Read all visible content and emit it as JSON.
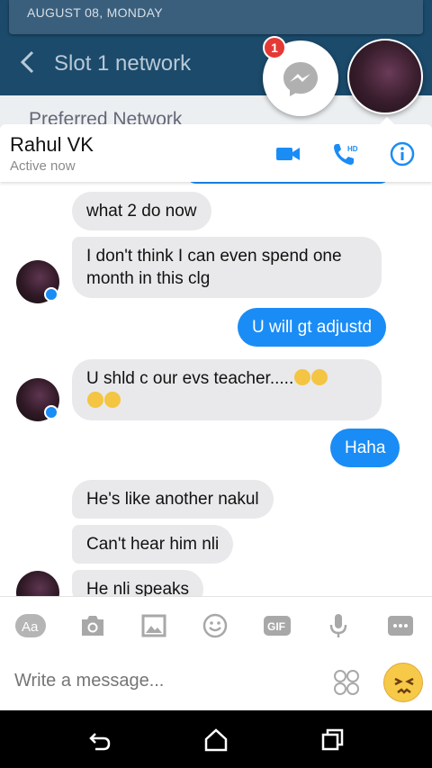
{
  "background_app": {
    "date": "AUGUST 08, MONDAY",
    "title": "Slot 1 network",
    "subtitle": "Preferred Network"
  },
  "chat_heads": {
    "messenger_unread": "1"
  },
  "header": {
    "name": "Rahul VK",
    "status": "Active now"
  },
  "messages": [
    {
      "side": "in",
      "text": "what 2 do now"
    },
    {
      "side": "in",
      "text": "I don't think I can even spend one month in this clg"
    },
    {
      "side": "out",
      "text": "U will gt adjustd"
    },
    {
      "side": "in",
      "text": "U shld c our evs teacher....."
    },
    {
      "side": "out",
      "text": "Haha"
    },
    {
      "side": "in",
      "text": "He's like another nakul"
    },
    {
      "side": "in",
      "text": "Can't hear him nli"
    },
    {
      "side": "in",
      "text": "He nli speaks"
    }
  ],
  "composer": {
    "placeholder": "Write a message..."
  },
  "colors": {
    "accent": "#1a8cf5",
    "incoming_bubble": "#e9e9eb",
    "badge": "#e53935"
  }
}
